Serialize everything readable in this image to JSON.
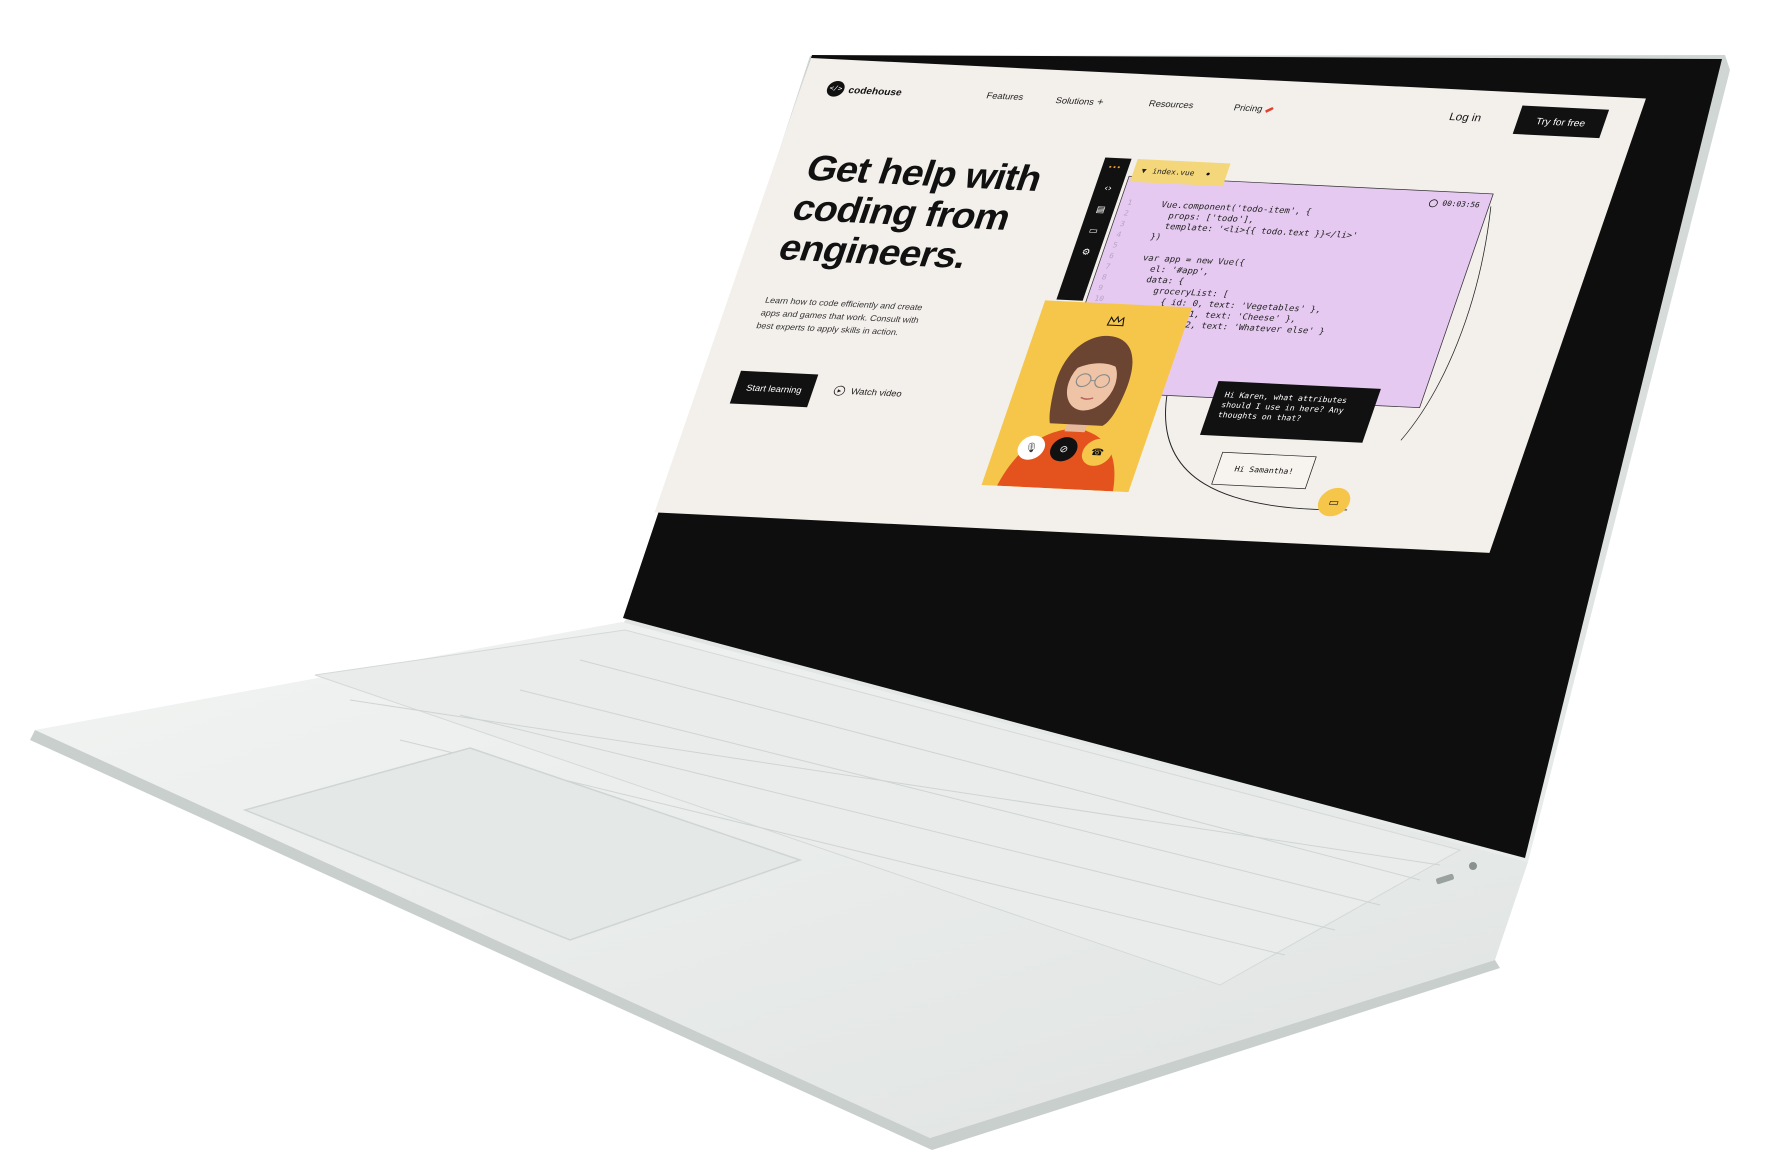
{
  "nav": {
    "logo_mark": "</>",
    "logo_text": "codehouse",
    "links": [
      "Features",
      "Solutions",
      "Resources",
      "Pricing"
    ],
    "solutions_plus": "+",
    "login": "Log in",
    "cta": "Try for free"
  },
  "hero": {
    "title": "Get help with coding from engineers.",
    "description": "Learn how to code efficiently and create apps and games that work. Consult with best experts to apply skills in action.",
    "primary_button": "Start learning",
    "secondary_button": "Watch video"
  },
  "editor": {
    "file_name": "index.vue",
    "timer": "00:03:56",
    "line_numbers": [
      "1",
      "2",
      "3",
      "4",
      "5",
      "6",
      "7",
      "8",
      "9",
      "10"
    ],
    "code": "Vue.component('todo-item', {\n  props: ['todo'],\n  template: '<li>{{ todo.text }}</li>'\n})\n\nvar app = new Vue({\n  el: '#app',\n  data: {\n    groceryList: [\n      { id: 0, text: 'Vegetables' },\n      { id: 1, text: 'Cheese' },\n      { id: 2, text: 'Whatever else' }\n    ]\n  }\n})",
    "toolbar_icons": [
      "code-icon",
      "document-icon",
      "comment-icon",
      "settings-icon"
    ]
  },
  "video_call": {
    "buttons": [
      "microphone-icon",
      "camera-off-icon",
      "hang-up-icon"
    ]
  },
  "chat": {
    "incoming": "Hi Karen, what attributes should I use in here? Any thoughts on that?",
    "reply": "Hi Samantha!"
  },
  "colors": {
    "page_bg": "#f3f0ec",
    "code_panel": "#e5c9f0",
    "accent_yellow": "#f6c64a",
    "dark": "#111111",
    "sweater": "#e4531e"
  }
}
